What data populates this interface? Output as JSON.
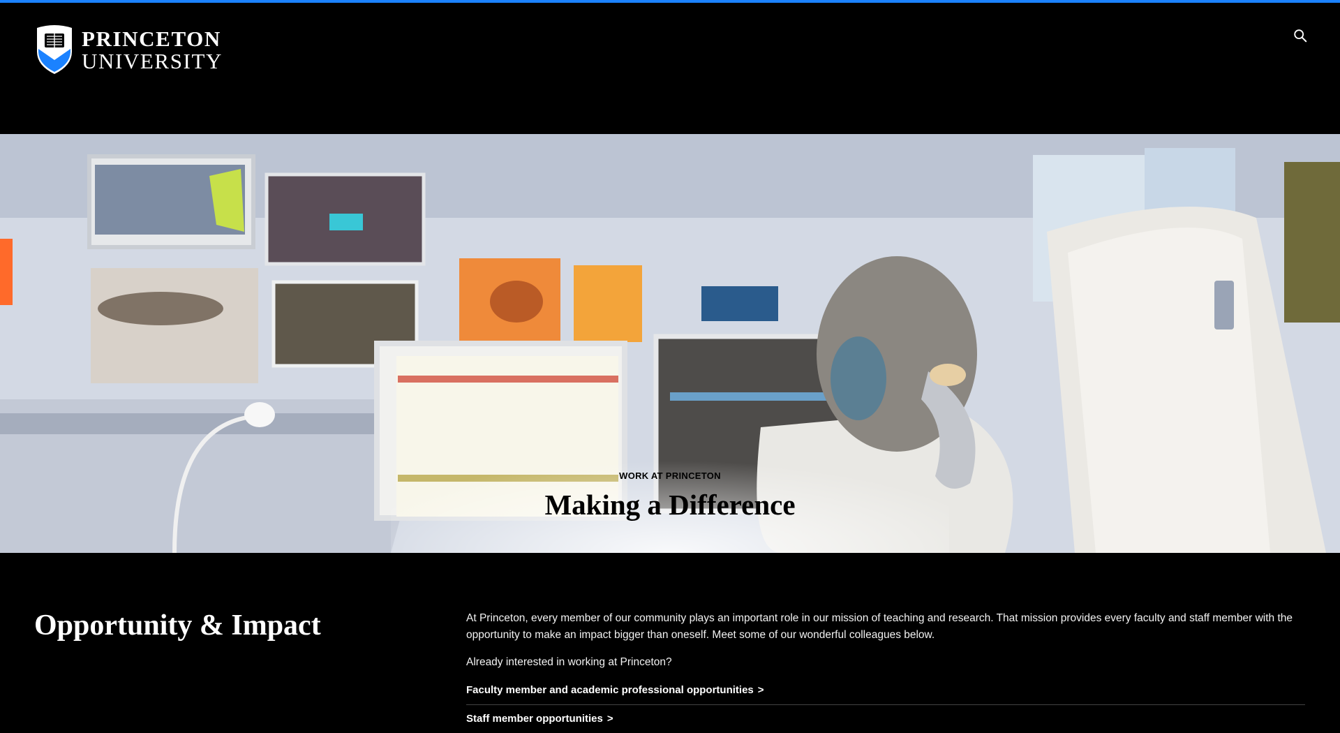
{
  "colors": {
    "accent": "#1b82ff",
    "background": "#000000",
    "text": "#ffffff",
    "shield_blue": "#1b82ff"
  },
  "header": {
    "logo": {
      "line1": "PRINCETON",
      "line2": "UNIVERSITY",
      "icon": "shield-icon"
    },
    "search": {
      "icon": "search-icon"
    }
  },
  "hero": {
    "eyebrow": "WORK AT PRINCETON",
    "title": "Making a Difference"
  },
  "content": {
    "title": "Opportunity & Impact",
    "intro": "At Princeton, every member of our community plays an important role in our mission of teaching and research. That mission provides every faculty and staff member with the opportunity to make an impact bigger than oneself. Meet some of our wonderful colleagues below.",
    "question": "Already interested in working at Princeton?",
    "links": [
      {
        "label": "Faculty member and academic professional opportunities",
        "chevron": ">"
      },
      {
        "label": "Staff member opportunities",
        "chevron": ">"
      }
    ]
  }
}
